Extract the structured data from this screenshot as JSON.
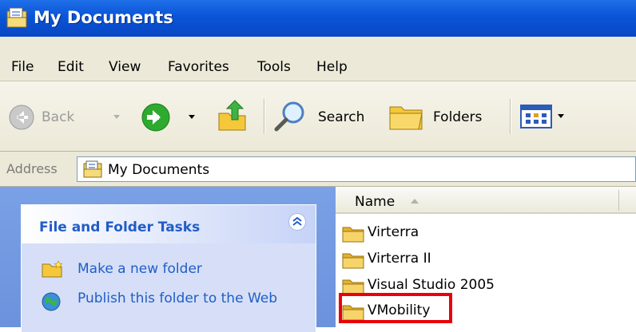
{
  "window": {
    "title": "My Documents"
  },
  "menu": [
    "File",
    "Edit",
    "View",
    "Favorites",
    "Tools",
    "Help"
  ],
  "toolbar": {
    "back_label": "Back",
    "search_label": "Search",
    "folders_label": "Folders"
  },
  "address": {
    "label": "Address",
    "value": "My Documents"
  },
  "tasks": {
    "title": "File and Folder Tasks",
    "items": [
      "Make a new folder",
      "Publish this folder to the Web"
    ]
  },
  "files": {
    "column_name": "Name",
    "items": [
      "Virterra",
      "Virterra II",
      "Visual Studio 2005",
      "VMobility"
    ],
    "highlighted": "VMobility"
  },
  "colors": {
    "title_bar": "#0a54d8",
    "task_link": "#215dc6",
    "highlight_box": "#e8000c",
    "folder_yellow": "#f5c83c"
  },
  "icons": {
    "title": "my-documents-icon",
    "back": "back-arrow-icon",
    "forward": "forward-arrow-icon",
    "up": "up-folder-icon",
    "search": "search-icon",
    "folders": "folders-icon",
    "views": "views-icon"
  }
}
